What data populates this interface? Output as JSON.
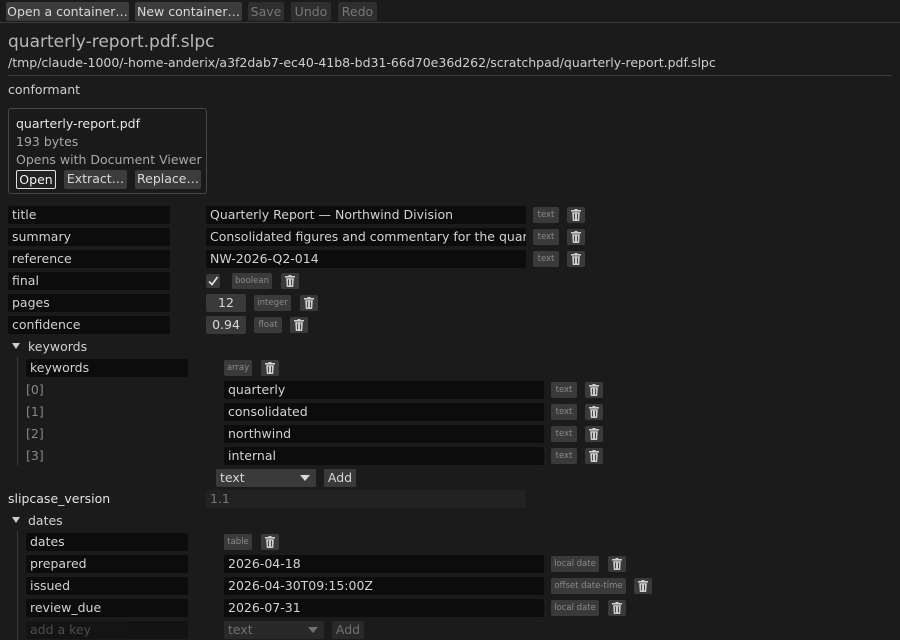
{
  "toolbar": {
    "open": "Open a container…",
    "new": "New container…",
    "save": "Save",
    "undo": "Undo",
    "redo": "Redo"
  },
  "file": {
    "title": "quarterly-report.pdf.slpc",
    "path": "/tmp/claude-1000/-home-anderix/a3f2dab7-ec40-41b8-bd31-66d70e36d262/scratchpad/quarterly-report.pdf.slpc",
    "status": "conformant"
  },
  "payload": {
    "name": "quarterly-report.pdf",
    "size": "193 bytes",
    "opens_with": "Opens with Document Viewer",
    "open_label": "Open",
    "extract_label": "Extract…",
    "replace_label": "Replace…"
  },
  "fields": {
    "title": {
      "key": "title",
      "value": "Quarterly Report — Northwind Division",
      "type": "text"
    },
    "summary": {
      "key": "summary",
      "value": "Consolidated figures and commentary for the quarter.",
      "type": "text"
    },
    "reference": {
      "key": "reference",
      "value": "NW-2026-Q2-014",
      "type": "text"
    },
    "final": {
      "key": "final",
      "checked": true,
      "type": "boolean"
    },
    "pages": {
      "key": "pages",
      "value": "12",
      "type": "integer"
    },
    "confidence": {
      "key": "confidence",
      "value": "0.94",
      "type": "float"
    }
  },
  "keywords": {
    "section": "keywords",
    "key": "keywords",
    "type": "array",
    "items": [
      {
        "index": "[0]",
        "value": "quarterly",
        "type": "text"
      },
      {
        "index": "[1]",
        "value": "consolidated",
        "type": "text"
      },
      {
        "index": "[2]",
        "value": "northwind",
        "type": "text"
      },
      {
        "index": "[3]",
        "value": "internal",
        "type": "text"
      }
    ],
    "add_type": "text",
    "add_label": "Add"
  },
  "slipcase_version": {
    "key": "slipcase_version",
    "value": "1.1"
  },
  "dates": {
    "section": "dates",
    "key": "dates",
    "type": "table",
    "rows": [
      {
        "key": "prepared",
        "value": "2026-04-18",
        "type": "local date"
      },
      {
        "key": "issued",
        "value": "2026-04-30T09:15:00Z",
        "type": "offset date-time"
      },
      {
        "key": "review_due",
        "value": "2026-07-31",
        "type": "local date"
      }
    ],
    "add_key_placeholder": "add a key",
    "add_type": "text",
    "add_label": "Add"
  }
}
